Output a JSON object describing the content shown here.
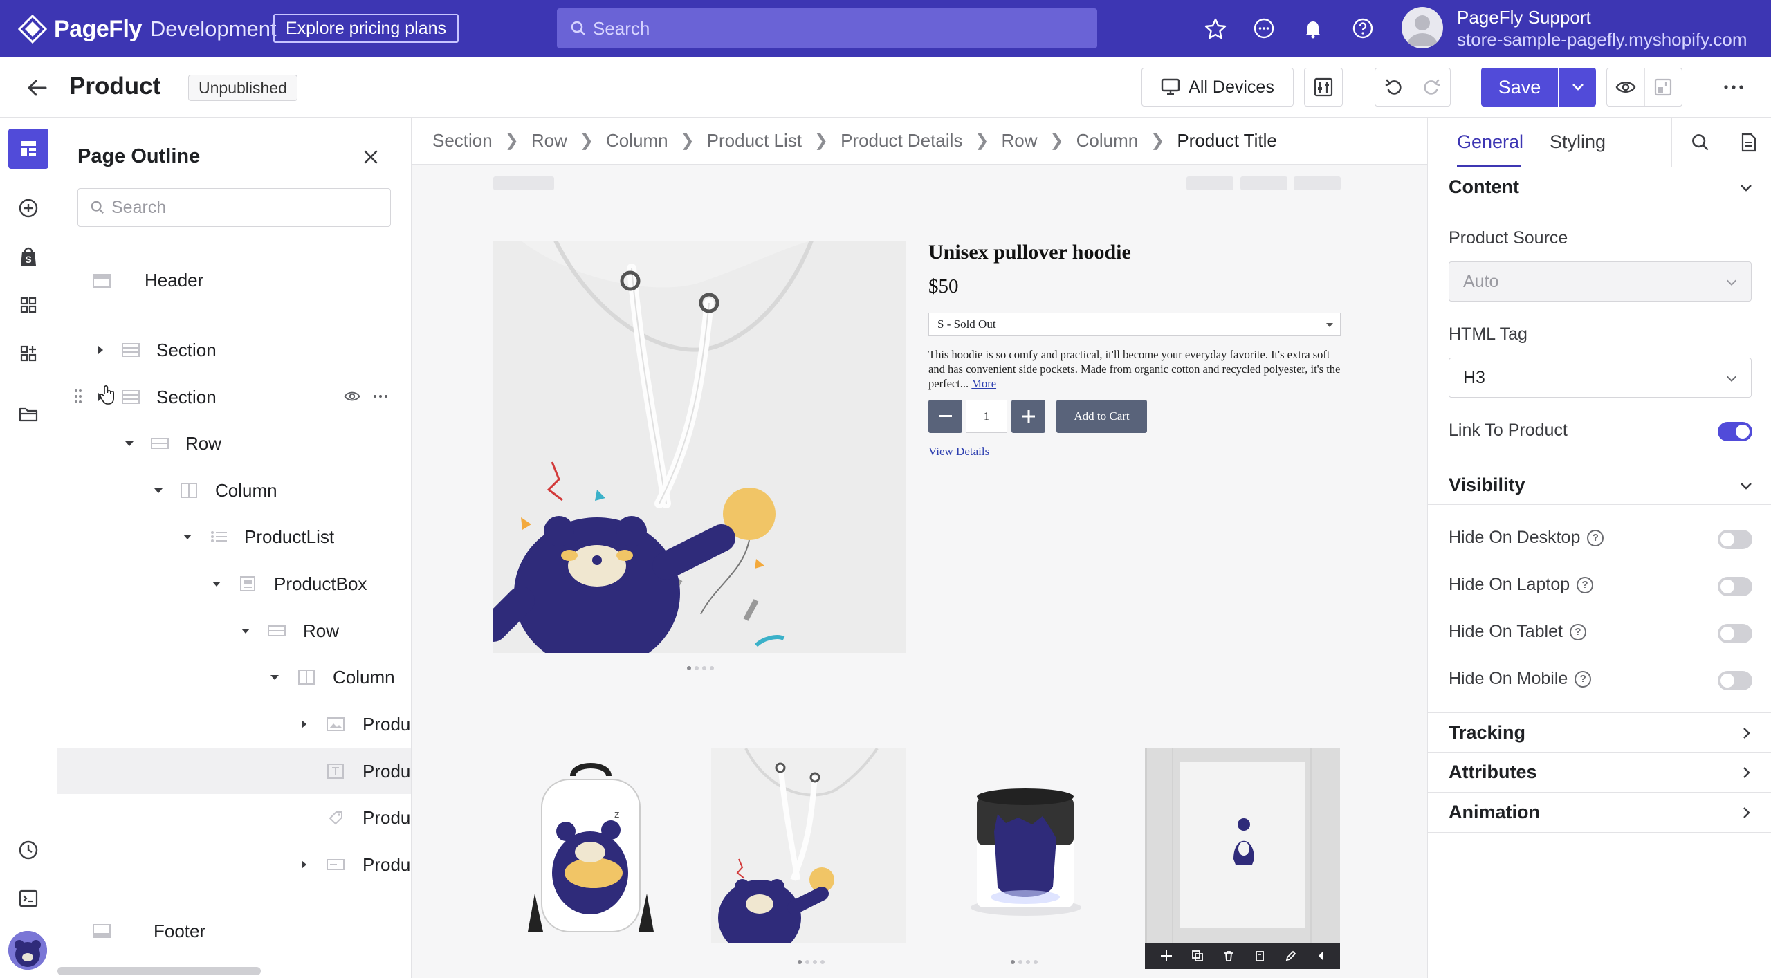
{
  "topbar": {
    "brand": "PageFly",
    "env": "Development",
    "explore_label": "Explore pricing plans",
    "search_placeholder": "Search",
    "user_name": "PageFly Support",
    "user_store": "store-sample-pagefly.myshopify.com",
    "icons": [
      "star-icon",
      "chat-icon",
      "bell-icon",
      "help-icon"
    ]
  },
  "subbar": {
    "title": "Product",
    "status": "Unpublished",
    "device_label": "All Devices",
    "save_label": "Save"
  },
  "rail": {
    "icons": [
      "layout-icon",
      "add-icon",
      "shopify-icon",
      "grid-icon",
      "apps-icon",
      "folder-icon",
      "history-icon",
      "terminal-icon"
    ],
    "accent": "#514bd9"
  },
  "outline": {
    "title": "Page Outline",
    "search_placeholder": "Search",
    "items": [
      {
        "label": "Header"
      },
      {
        "label": "Section"
      },
      {
        "label": "Section"
      },
      {
        "label": "Row"
      },
      {
        "label": "Column"
      },
      {
        "label": "ProductList"
      },
      {
        "label": "ProductBox"
      },
      {
        "label": "Row"
      },
      {
        "label": "Column"
      },
      {
        "label": "Produ"
      },
      {
        "label": "Produ"
      },
      {
        "label": "Produ"
      },
      {
        "label": "Produ"
      },
      {
        "label": "Footer"
      }
    ]
  },
  "canvas": {
    "breadcrumbs": [
      "Section",
      "Row",
      "Column",
      "Product List",
      "Product Details",
      "Row",
      "Column",
      "Product Title"
    ],
    "product": {
      "title": "Unisex pullover hoodie",
      "price": "$50",
      "variant": "S - Sold Out",
      "description": "This hoodie is so comfy and practical, it'll become your everyday favorite. It's extra soft and has convenient side pockets. Made from organic cotton and recycled polyester, it's the perfect...",
      "more_label": "More",
      "quantity": "1",
      "add_to_cart": "Add to Cart",
      "view_details": "View Details"
    }
  },
  "rpanel": {
    "tabs": [
      "General",
      "Styling"
    ],
    "sections": {
      "content": "Content",
      "visibility": "Visibility",
      "tracking": "Tracking",
      "attributes": "Attributes",
      "animation": "Animation"
    },
    "product_source_label": "Product Source",
    "product_source_value": "Auto",
    "html_tag_label": "HTML Tag",
    "html_tag_value": "H3",
    "link_to_product_label": "Link To Product",
    "link_to_product_on": true,
    "visibility": [
      {
        "label": "Hide On Desktop",
        "on": false
      },
      {
        "label": "Hide On Laptop",
        "on": false
      },
      {
        "label": "Hide On Tablet",
        "on": false
      },
      {
        "label": "Hide On Mobile",
        "on": false
      }
    ]
  },
  "colors": {
    "topbar_bg": "#3d36b3",
    "primary": "#514bd9",
    "cart_button": "#59637a",
    "link": "#2d3fb0"
  }
}
